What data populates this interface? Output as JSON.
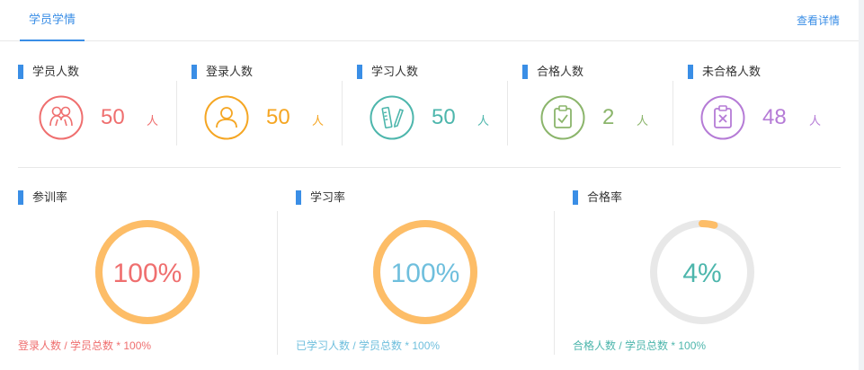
{
  "header": {
    "tab_label": "学员学情",
    "detail_link": "查看详情"
  },
  "stats": [
    {
      "label": "学员人数",
      "value": "50",
      "unit": "人",
      "color": "#ef6f6f",
      "icon": "students-icon"
    },
    {
      "label": "登录人数",
      "value": "50",
      "unit": "人",
      "color": "#f5a623",
      "icon": "user-icon"
    },
    {
      "label": "学习人数",
      "value": "50",
      "unit": "人",
      "color": "#4db6ac",
      "icon": "ruler-pencil-icon"
    },
    {
      "label": "合格人数",
      "value": "2",
      "unit": "人",
      "color": "#8bb56b",
      "icon": "clipboard-check-icon"
    },
    {
      "label": "未合格人数",
      "value": "48",
      "unit": "人",
      "color": "#b57bd6",
      "icon": "clipboard-x-icon"
    }
  ],
  "rates": [
    {
      "label": "参训率",
      "value": "100%",
      "percent": 100,
      "text_color": "#ef6f6f",
      "formula": "登录人数 / 学员总数 * 100%",
      "formula_color": "#ef6f6f"
    },
    {
      "label": "学习率",
      "value": "100%",
      "percent": 100,
      "text_color": "#6fbfdd",
      "formula": "已学习人数 / 学员总数 * 100%",
      "formula_color": "#6fbfdd"
    },
    {
      "label": "合格率",
      "value": "4%",
      "percent": 4,
      "text_color": "#4db6ac",
      "formula": "合格人数 / 学员总数 * 100%",
      "formula_color": "#4db6ac"
    }
  ],
  "colors": {
    "accent": "#3a8ee6",
    "ring_progress": "#fdbd67",
    "ring_track": "#e8e8e8"
  }
}
